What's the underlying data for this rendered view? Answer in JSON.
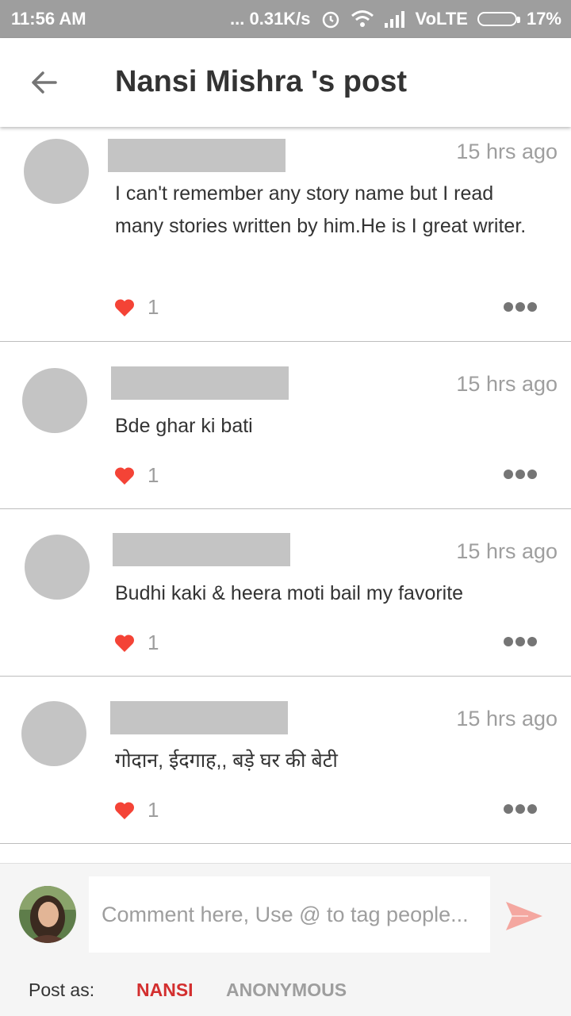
{
  "status_bar": {
    "time": "11:56 AM",
    "net_speed": "... 0.31K/s",
    "network_label": "VoLTE",
    "battery": "17%"
  },
  "header": {
    "title": "Nansi Mishra 's post",
    "back_icon": "arrow-left-icon"
  },
  "comments": [
    {
      "time": "15 hrs ago",
      "text": "I can't remember any story name but I read many stories written by him.He is I great writer.",
      "likes": "1"
    },
    {
      "time": "15 hrs ago",
      "text": "Bde ghar ki bati",
      "likes": "1"
    },
    {
      "time": "15 hrs ago",
      "text": "Budhi kaki & heera moti bail my favorite",
      "likes": "1"
    },
    {
      "time": "15 hrs ago",
      "text": "गोदान, ईदगाह,, बड़े घर की  बेटी",
      "likes": "1"
    }
  ],
  "composer": {
    "placeholder": "Comment here, Use @ to tag people...",
    "post_as_label": "Post as:",
    "option_user": "NANSI",
    "option_anonymous": "ANONYMOUS"
  },
  "colors": {
    "accent_red": "#d32f2f",
    "heart": "#f44336",
    "send": "#f4a7a0",
    "status_bar": "#9e9e9e"
  }
}
